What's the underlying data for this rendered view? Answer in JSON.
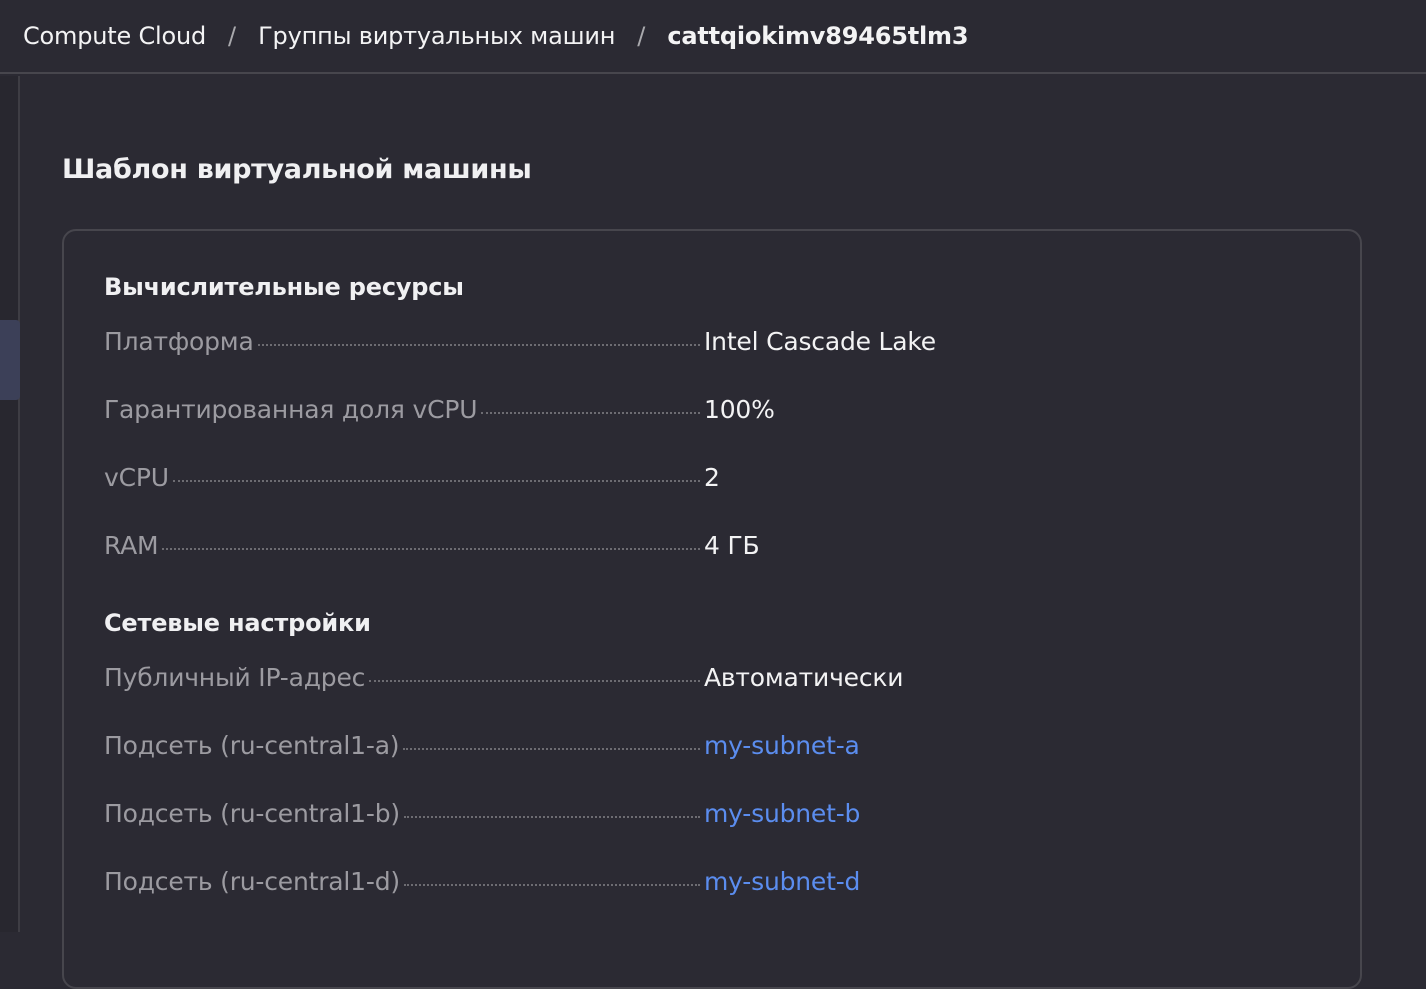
{
  "breadcrumb": {
    "items": [
      {
        "label": "Compute Cloud"
      },
      {
        "label": "Группы виртуальных машин"
      },
      {
        "label": "cattqiokimv89465tlm3"
      }
    ],
    "separator": "/"
  },
  "page": {
    "section_title": "Шаблон виртуальной машины"
  },
  "compute": {
    "title": "Вычислительные ресурсы",
    "rows": [
      {
        "label": "Платформа",
        "value": "Intel Cascade Lake"
      },
      {
        "label": "Гарантированная доля vCPU",
        "value": "100%"
      },
      {
        "label": "vCPU",
        "value": "2"
      },
      {
        "label": "RAM",
        "value": "4 ГБ"
      }
    ]
  },
  "network": {
    "title": "Сетевые настройки",
    "rows": [
      {
        "label": "Публичный IP-адрес",
        "value": "Автоматически"
      },
      {
        "label": "Подсеть (ru-central1-a)",
        "value": "my-subnet-a"
      },
      {
        "label": "Подсеть (ru-central1-b)",
        "value": "my-subnet-b"
      },
      {
        "label": "Подсеть (ru-central1-d)",
        "value": "my-subnet-d"
      }
    ]
  },
  "colors": {
    "background": "#2b2a33",
    "link": "#5b8def",
    "label": "#9c9ba1",
    "text": "#f3f3f4"
  }
}
